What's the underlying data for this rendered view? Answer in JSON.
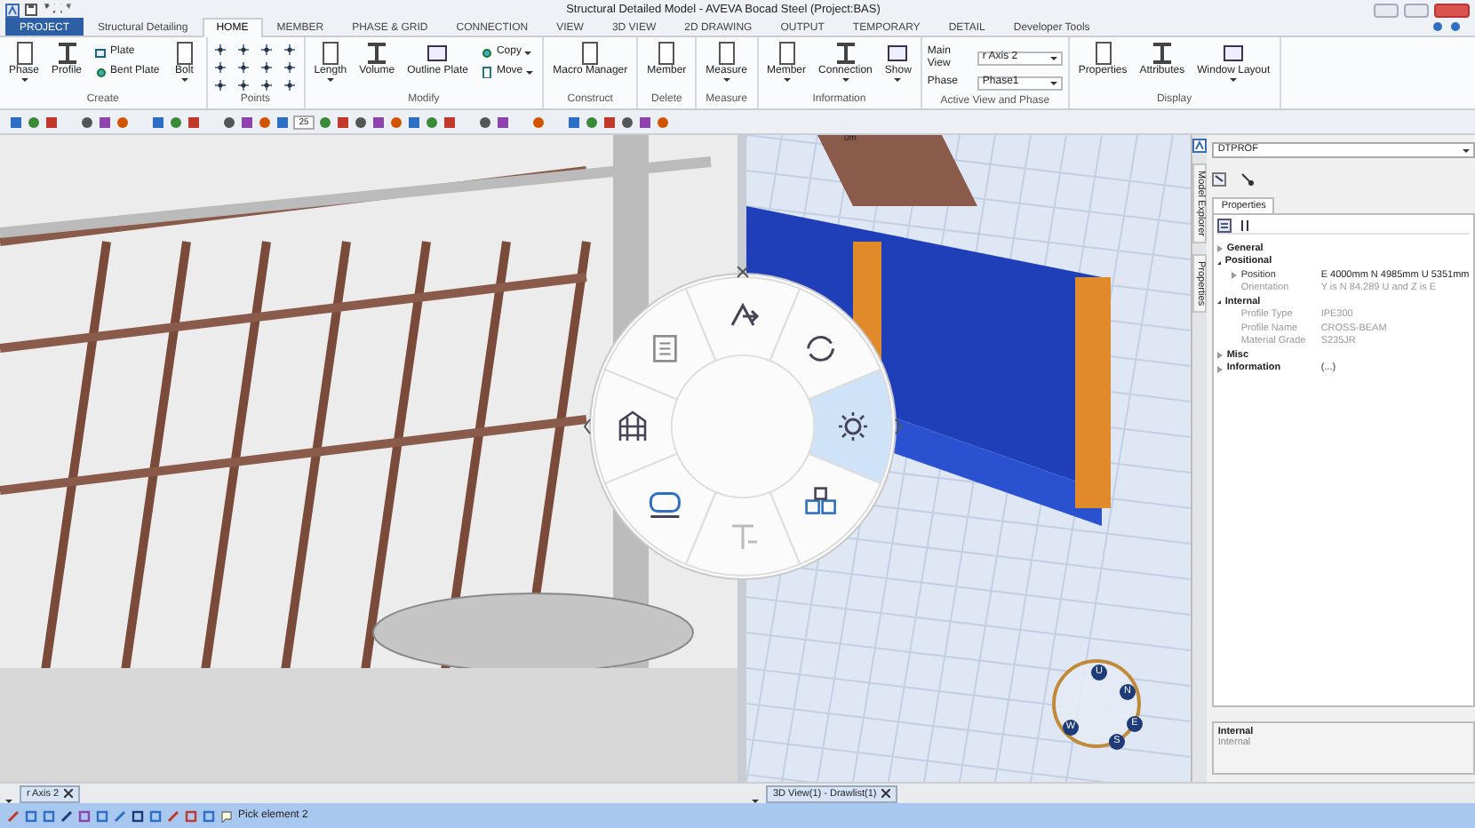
{
  "window": {
    "title": "Structural Detailed Model - AVEVA Bocad Steel (Project:BAS)"
  },
  "ribbon_tabs": [
    {
      "label": "PROJECT",
      "kind": "file",
      "selected": false
    },
    {
      "label": "Structural Detailing",
      "kind": "tab",
      "selected": false
    },
    {
      "label": "HOME",
      "kind": "tab",
      "selected": true
    },
    {
      "label": "MEMBER",
      "kind": "tab",
      "selected": false
    },
    {
      "label": "PHASE & GRID",
      "kind": "tab",
      "selected": false
    },
    {
      "label": "CONNECTION",
      "kind": "tab",
      "selected": false
    },
    {
      "label": "VIEW",
      "kind": "tab",
      "selected": false
    },
    {
      "label": "3D VIEW",
      "kind": "tab",
      "selected": false
    },
    {
      "label": "2D DRAWING",
      "kind": "tab",
      "selected": false
    },
    {
      "label": "OUTPUT",
      "kind": "tab",
      "selected": false
    },
    {
      "label": "TEMPORARY",
      "kind": "tab",
      "selected": false
    },
    {
      "label": "DETAIL",
      "kind": "tab",
      "selected": false
    },
    {
      "label": "Developer Tools",
      "kind": "tab",
      "selected": false
    }
  ],
  "ribbon_groups": [
    {
      "label": "Create",
      "items": [
        {
          "kind": "large",
          "label": "Phase",
          "dropdown": true
        },
        {
          "kind": "large",
          "label": "Profile",
          "dropdown": false
        },
        {
          "kind": "small",
          "label": "Plate",
          "dropdown": false
        },
        {
          "kind": "small",
          "label": "Bent Plate",
          "dropdown": false
        },
        {
          "kind": "large",
          "label": "Bolt",
          "dropdown": true
        }
      ]
    },
    {
      "label": "Points",
      "items": [
        {
          "kind": "points"
        }
      ]
    },
    {
      "label": "Modify",
      "items": [
        {
          "kind": "large",
          "label": "Length",
          "dropdown": true
        },
        {
          "kind": "large",
          "label": "Volume",
          "dropdown": false
        },
        {
          "kind": "large",
          "label": "Outline Plate",
          "dropdown": false
        },
        {
          "kind": "small",
          "label": "Copy",
          "dropdown": true
        },
        {
          "kind": "small",
          "label": "Move",
          "dropdown": true
        }
      ]
    },
    {
      "label": "Construct",
      "items": [
        {
          "kind": "large",
          "label": "Macro Manager",
          "dropdown": false
        }
      ]
    },
    {
      "label": "Delete",
      "items": [
        {
          "kind": "large",
          "label": "Member",
          "dropdown": false
        }
      ]
    },
    {
      "label": "Measure",
      "items": [
        {
          "kind": "large",
          "label": "Measure",
          "dropdown": true
        }
      ]
    },
    {
      "label": "Information",
      "items": [
        {
          "kind": "large",
          "label": "Member",
          "dropdown": true
        },
        {
          "kind": "large",
          "label": "Connection",
          "dropdown": true
        },
        {
          "kind": "large",
          "label": "Show",
          "dropdown": true
        }
      ]
    },
    {
      "label": "Active View and Phase",
      "items": [
        {
          "kind": "field",
          "label": "Main View",
          "value": "r Axis 2"
        },
        {
          "kind": "field",
          "label": "Phase",
          "value": "Phase1"
        }
      ]
    },
    {
      "label": "Display",
      "items": [
        {
          "kind": "large",
          "label": "Properties",
          "dropdown": false
        },
        {
          "kind": "large",
          "label": "Attributes",
          "dropdown": false
        },
        {
          "kind": "large",
          "label": "Window Layout",
          "dropdown": true
        }
      ]
    }
  ],
  "toolbar": {
    "zoom_value": "25"
  },
  "right_view": {
    "scale_label": "0m",
    "compass": [
      "U",
      "N",
      "E",
      "S",
      "W"
    ]
  },
  "radial_menu": {
    "items": [
      {
        "kind": "arrow",
        "selected": false
      },
      {
        "kind": "rotate",
        "selected": false
      },
      {
        "kind": "sun",
        "selected": true
      },
      {
        "kind": "cubes",
        "selected": false
      },
      {
        "kind": "text",
        "selected": false
      },
      {
        "kind": "pipe",
        "selected": false
      },
      {
        "kind": "frame",
        "selected": false
      },
      {
        "kind": "page",
        "selected": false
      }
    ]
  },
  "side_tabs": [
    "Model Explorer",
    "Properties"
  ],
  "properties_panel": {
    "object_selector": "DTPROF",
    "tab": "Properties",
    "categories": [
      {
        "label": "General",
        "expanded": false
      },
      {
        "label": "Positional",
        "expanded": true,
        "children": [
          {
            "label": "Position",
            "value": "E 4000mm N 4985mm U 5351mm",
            "expanded": false
          },
          {
            "label": "Orientation",
            "value": "Y is N 84.289 U and Z is E"
          }
        ]
      },
      {
        "label": "Internal",
        "expanded": true,
        "children": [
          {
            "label": "Profile Type",
            "value": "IPE300"
          },
          {
            "label": "Profile Name",
            "value": "CROSS-BEAM"
          },
          {
            "label": "Material Grade",
            "value": "S235JR"
          }
        ]
      },
      {
        "label": "Misc",
        "expanded": false
      },
      {
        "label": "Information",
        "expanded": false,
        "value": "(...)"
      }
    ],
    "description": {
      "title": "Internal",
      "text": "Internal"
    }
  },
  "view_tabs": [
    {
      "label": "r Axis 2"
    },
    {
      "label": "3D View(1) - Drawlist(1)"
    }
  ],
  "status_bar": {
    "message": "Pick element 2"
  }
}
